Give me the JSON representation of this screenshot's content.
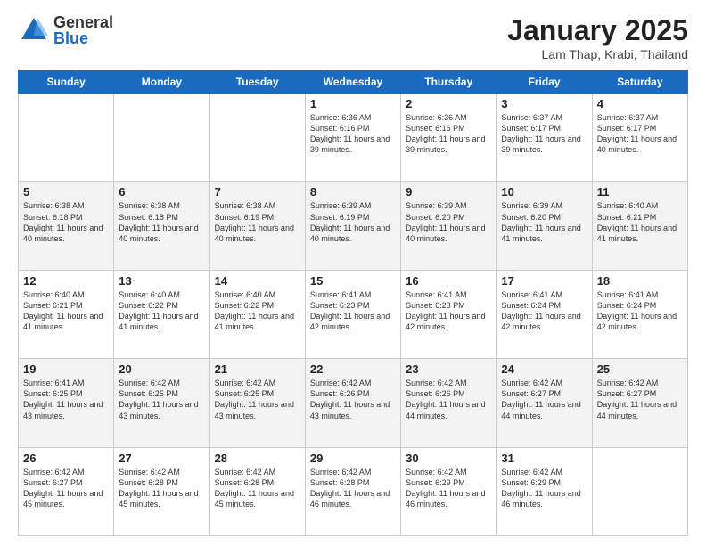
{
  "header": {
    "logo_general": "General",
    "logo_blue": "Blue",
    "month": "January 2025",
    "location": "Lam Thap, Krabi, Thailand"
  },
  "weekdays": [
    "Sunday",
    "Monday",
    "Tuesday",
    "Wednesday",
    "Thursday",
    "Friday",
    "Saturday"
  ],
  "weeks": [
    [
      {
        "day": "",
        "info": ""
      },
      {
        "day": "",
        "info": ""
      },
      {
        "day": "",
        "info": ""
      },
      {
        "day": "1",
        "info": "Sunrise: 6:36 AM\nSunset: 6:16 PM\nDaylight: 11 hours and 39 minutes."
      },
      {
        "day": "2",
        "info": "Sunrise: 6:36 AM\nSunset: 6:16 PM\nDaylight: 11 hours and 39 minutes."
      },
      {
        "day": "3",
        "info": "Sunrise: 6:37 AM\nSunset: 6:17 PM\nDaylight: 11 hours and 39 minutes."
      },
      {
        "day": "4",
        "info": "Sunrise: 6:37 AM\nSunset: 6:17 PM\nDaylight: 11 hours and 40 minutes."
      }
    ],
    [
      {
        "day": "5",
        "info": "Sunrise: 6:38 AM\nSunset: 6:18 PM\nDaylight: 11 hours and 40 minutes."
      },
      {
        "day": "6",
        "info": "Sunrise: 6:38 AM\nSunset: 6:18 PM\nDaylight: 11 hours and 40 minutes."
      },
      {
        "day": "7",
        "info": "Sunrise: 6:38 AM\nSunset: 6:19 PM\nDaylight: 11 hours and 40 minutes."
      },
      {
        "day": "8",
        "info": "Sunrise: 6:39 AM\nSunset: 6:19 PM\nDaylight: 11 hours and 40 minutes."
      },
      {
        "day": "9",
        "info": "Sunrise: 6:39 AM\nSunset: 6:20 PM\nDaylight: 11 hours and 40 minutes."
      },
      {
        "day": "10",
        "info": "Sunrise: 6:39 AM\nSunset: 6:20 PM\nDaylight: 11 hours and 41 minutes."
      },
      {
        "day": "11",
        "info": "Sunrise: 6:40 AM\nSunset: 6:21 PM\nDaylight: 11 hours and 41 minutes."
      }
    ],
    [
      {
        "day": "12",
        "info": "Sunrise: 6:40 AM\nSunset: 6:21 PM\nDaylight: 11 hours and 41 minutes."
      },
      {
        "day": "13",
        "info": "Sunrise: 6:40 AM\nSunset: 6:22 PM\nDaylight: 11 hours and 41 minutes."
      },
      {
        "day": "14",
        "info": "Sunrise: 6:40 AM\nSunset: 6:22 PM\nDaylight: 11 hours and 41 minutes."
      },
      {
        "day": "15",
        "info": "Sunrise: 6:41 AM\nSunset: 6:23 PM\nDaylight: 11 hours and 42 minutes."
      },
      {
        "day": "16",
        "info": "Sunrise: 6:41 AM\nSunset: 6:23 PM\nDaylight: 11 hours and 42 minutes."
      },
      {
        "day": "17",
        "info": "Sunrise: 6:41 AM\nSunset: 6:24 PM\nDaylight: 11 hours and 42 minutes."
      },
      {
        "day": "18",
        "info": "Sunrise: 6:41 AM\nSunset: 6:24 PM\nDaylight: 11 hours and 42 minutes."
      }
    ],
    [
      {
        "day": "19",
        "info": "Sunrise: 6:41 AM\nSunset: 6:25 PM\nDaylight: 11 hours and 43 minutes."
      },
      {
        "day": "20",
        "info": "Sunrise: 6:42 AM\nSunset: 6:25 PM\nDaylight: 11 hours and 43 minutes."
      },
      {
        "day": "21",
        "info": "Sunrise: 6:42 AM\nSunset: 6:25 PM\nDaylight: 11 hours and 43 minutes."
      },
      {
        "day": "22",
        "info": "Sunrise: 6:42 AM\nSunset: 6:26 PM\nDaylight: 11 hours and 43 minutes."
      },
      {
        "day": "23",
        "info": "Sunrise: 6:42 AM\nSunset: 6:26 PM\nDaylight: 11 hours and 44 minutes."
      },
      {
        "day": "24",
        "info": "Sunrise: 6:42 AM\nSunset: 6:27 PM\nDaylight: 11 hours and 44 minutes."
      },
      {
        "day": "25",
        "info": "Sunrise: 6:42 AM\nSunset: 6:27 PM\nDaylight: 11 hours and 44 minutes."
      }
    ],
    [
      {
        "day": "26",
        "info": "Sunrise: 6:42 AM\nSunset: 6:27 PM\nDaylight: 11 hours and 45 minutes."
      },
      {
        "day": "27",
        "info": "Sunrise: 6:42 AM\nSunset: 6:28 PM\nDaylight: 11 hours and 45 minutes."
      },
      {
        "day": "28",
        "info": "Sunrise: 6:42 AM\nSunset: 6:28 PM\nDaylight: 11 hours and 45 minutes."
      },
      {
        "day": "29",
        "info": "Sunrise: 6:42 AM\nSunset: 6:28 PM\nDaylight: 11 hours and 46 minutes."
      },
      {
        "day": "30",
        "info": "Sunrise: 6:42 AM\nSunset: 6:29 PM\nDaylight: 11 hours and 46 minutes."
      },
      {
        "day": "31",
        "info": "Sunrise: 6:42 AM\nSunset: 6:29 PM\nDaylight: 11 hours and 46 minutes."
      },
      {
        "day": "",
        "info": ""
      }
    ]
  ]
}
